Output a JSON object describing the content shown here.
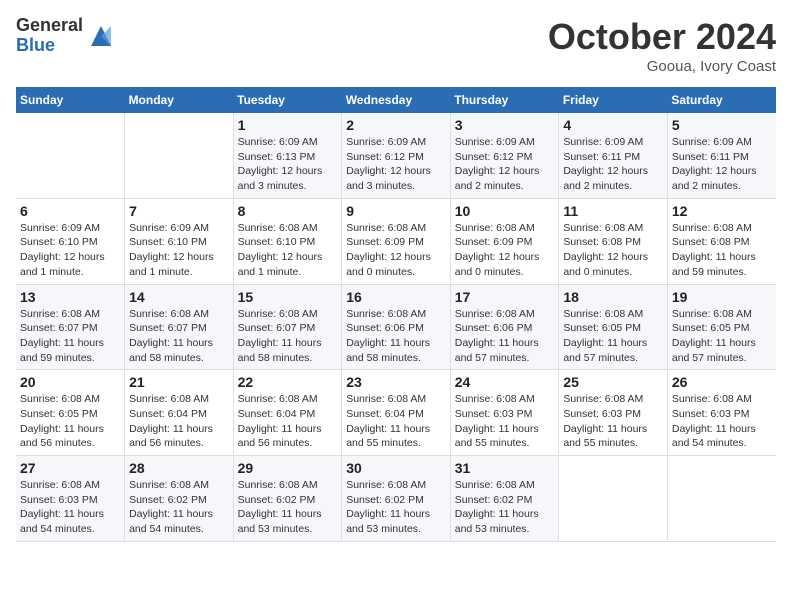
{
  "logo": {
    "general": "General",
    "blue": "Blue"
  },
  "title": "October 2024",
  "subtitle": "Gooua, Ivory Coast",
  "days_of_week": [
    "Sunday",
    "Monday",
    "Tuesday",
    "Wednesday",
    "Thursday",
    "Friday",
    "Saturday"
  ],
  "weeks": [
    [
      {
        "day": "",
        "info": ""
      },
      {
        "day": "",
        "info": ""
      },
      {
        "day": "1",
        "info": "Sunrise: 6:09 AM\nSunset: 6:13 PM\nDaylight: 12 hours and 3 minutes."
      },
      {
        "day": "2",
        "info": "Sunrise: 6:09 AM\nSunset: 6:12 PM\nDaylight: 12 hours and 3 minutes."
      },
      {
        "day": "3",
        "info": "Sunrise: 6:09 AM\nSunset: 6:12 PM\nDaylight: 12 hours and 2 minutes."
      },
      {
        "day": "4",
        "info": "Sunrise: 6:09 AM\nSunset: 6:11 PM\nDaylight: 12 hours and 2 minutes."
      },
      {
        "day": "5",
        "info": "Sunrise: 6:09 AM\nSunset: 6:11 PM\nDaylight: 12 hours and 2 minutes."
      }
    ],
    [
      {
        "day": "6",
        "info": "Sunrise: 6:09 AM\nSunset: 6:10 PM\nDaylight: 12 hours and 1 minute."
      },
      {
        "day": "7",
        "info": "Sunrise: 6:09 AM\nSunset: 6:10 PM\nDaylight: 12 hours and 1 minute."
      },
      {
        "day": "8",
        "info": "Sunrise: 6:08 AM\nSunset: 6:10 PM\nDaylight: 12 hours and 1 minute."
      },
      {
        "day": "9",
        "info": "Sunrise: 6:08 AM\nSunset: 6:09 PM\nDaylight: 12 hours and 0 minutes."
      },
      {
        "day": "10",
        "info": "Sunrise: 6:08 AM\nSunset: 6:09 PM\nDaylight: 12 hours and 0 minutes."
      },
      {
        "day": "11",
        "info": "Sunrise: 6:08 AM\nSunset: 6:08 PM\nDaylight: 12 hours and 0 minutes."
      },
      {
        "day": "12",
        "info": "Sunrise: 6:08 AM\nSunset: 6:08 PM\nDaylight: 11 hours and 59 minutes."
      }
    ],
    [
      {
        "day": "13",
        "info": "Sunrise: 6:08 AM\nSunset: 6:07 PM\nDaylight: 11 hours and 59 minutes."
      },
      {
        "day": "14",
        "info": "Sunrise: 6:08 AM\nSunset: 6:07 PM\nDaylight: 11 hours and 58 minutes."
      },
      {
        "day": "15",
        "info": "Sunrise: 6:08 AM\nSunset: 6:07 PM\nDaylight: 11 hours and 58 minutes."
      },
      {
        "day": "16",
        "info": "Sunrise: 6:08 AM\nSunset: 6:06 PM\nDaylight: 11 hours and 58 minutes."
      },
      {
        "day": "17",
        "info": "Sunrise: 6:08 AM\nSunset: 6:06 PM\nDaylight: 11 hours and 57 minutes."
      },
      {
        "day": "18",
        "info": "Sunrise: 6:08 AM\nSunset: 6:05 PM\nDaylight: 11 hours and 57 minutes."
      },
      {
        "day": "19",
        "info": "Sunrise: 6:08 AM\nSunset: 6:05 PM\nDaylight: 11 hours and 57 minutes."
      }
    ],
    [
      {
        "day": "20",
        "info": "Sunrise: 6:08 AM\nSunset: 6:05 PM\nDaylight: 11 hours and 56 minutes."
      },
      {
        "day": "21",
        "info": "Sunrise: 6:08 AM\nSunset: 6:04 PM\nDaylight: 11 hours and 56 minutes."
      },
      {
        "day": "22",
        "info": "Sunrise: 6:08 AM\nSunset: 6:04 PM\nDaylight: 11 hours and 56 minutes."
      },
      {
        "day": "23",
        "info": "Sunrise: 6:08 AM\nSunset: 6:04 PM\nDaylight: 11 hours and 55 minutes."
      },
      {
        "day": "24",
        "info": "Sunrise: 6:08 AM\nSunset: 6:03 PM\nDaylight: 11 hours and 55 minutes."
      },
      {
        "day": "25",
        "info": "Sunrise: 6:08 AM\nSunset: 6:03 PM\nDaylight: 11 hours and 55 minutes."
      },
      {
        "day": "26",
        "info": "Sunrise: 6:08 AM\nSunset: 6:03 PM\nDaylight: 11 hours and 54 minutes."
      }
    ],
    [
      {
        "day": "27",
        "info": "Sunrise: 6:08 AM\nSunset: 6:03 PM\nDaylight: 11 hours and 54 minutes."
      },
      {
        "day": "28",
        "info": "Sunrise: 6:08 AM\nSunset: 6:02 PM\nDaylight: 11 hours and 54 minutes."
      },
      {
        "day": "29",
        "info": "Sunrise: 6:08 AM\nSunset: 6:02 PM\nDaylight: 11 hours and 53 minutes."
      },
      {
        "day": "30",
        "info": "Sunrise: 6:08 AM\nSunset: 6:02 PM\nDaylight: 11 hours and 53 minutes."
      },
      {
        "day": "31",
        "info": "Sunrise: 6:08 AM\nSunset: 6:02 PM\nDaylight: 11 hours and 53 minutes."
      },
      {
        "day": "",
        "info": ""
      },
      {
        "day": "",
        "info": ""
      }
    ]
  ]
}
